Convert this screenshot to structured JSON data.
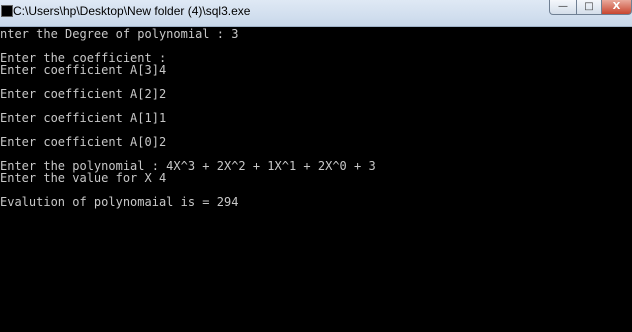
{
  "window": {
    "title": "C:\\Users\\hp\\Desktop\\New folder (4)\\sql3.exe",
    "controls": {
      "minimize": "—",
      "maximize": "□",
      "close": "X"
    }
  },
  "console": {
    "lines": [
      "nter the Degree of polynomial : 3",
      "Enter the coefficient :",
      "Enter coefficient A[3]4",
      "Enter coefficient A[2]2",
      "Enter coefficient A[1]1",
      "Enter coefficient A[0]2",
      "Enter the polynomial : 4X^3 + 2X^2 + 1X^1 + 2X^0 + 3",
      "Enter the value for X 4",
      "Evalution of polynomaial is = 294"
    ]
  }
}
